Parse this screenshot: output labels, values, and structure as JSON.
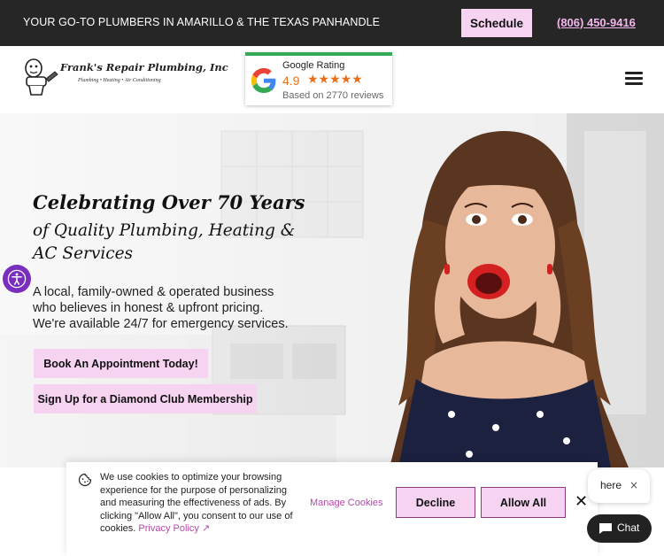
{
  "topbar": {
    "tagline": "YOUR GO-TO PLUMBERS IN AMARILLO & THE TEXAS PANHANDLE",
    "schedule_label": "Schedule",
    "phone": "(806) 450-9416"
  },
  "header": {
    "logo_text": "Frank's Repair Plumbing, Inc",
    "logo_sub": "Plumbing • Heating • Air Conditioning",
    "rating": {
      "title": "Google Rating",
      "score": "4.9",
      "stars": "★★★★★",
      "count_text": "Based on 2770 reviews"
    }
  },
  "hero": {
    "headline1": "Celebrating Over 70 Years",
    "headline2": "of Quality Plumbing, Heating & AC Services",
    "description": "A local, family-owned & operated business who believes in honest & upfront pricing. We're available 24/7 for emergency services.",
    "button1": "Book An Appointment Today!",
    "button2": "Sign Up for a Diamond Club Membership"
  },
  "cookie": {
    "text": "We use cookies to optimize your browsing experience for the purpose of personalizing and measuring the effectiveness of ads. By clicking \"Allow All\", you consent to our use of cookies.",
    "privacy_link": "Privacy Policy ↗",
    "manage": "Manage Cookies",
    "decline": "Decline",
    "allow": "Allow All",
    "close": "✕"
  },
  "chat": {
    "bubble_text": "here",
    "bubble_close": "×",
    "button_label": "Chat"
  },
  "colors": {
    "topbar_bg": "#262626",
    "accent_pink": "#f6d3f1",
    "phone_pink": "#f3b7ec",
    "link_purple": "#b44aa6",
    "accessibility_purple": "#7a2ebd",
    "rating_star": "#e7711b"
  }
}
